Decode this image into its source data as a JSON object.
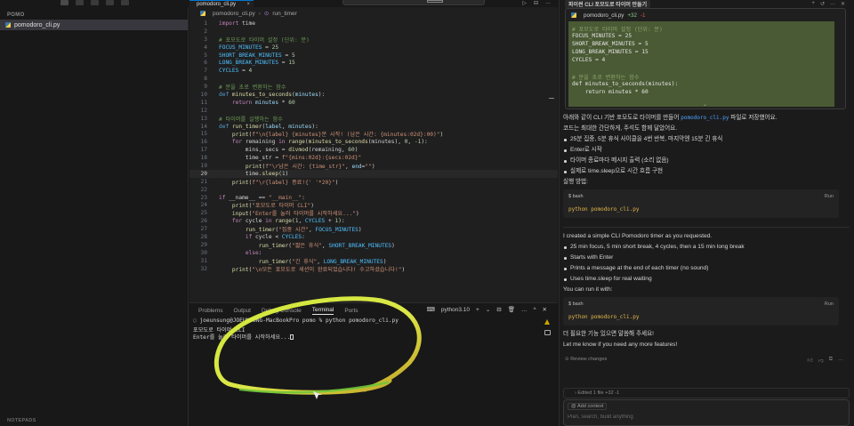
{
  "sidebar": {
    "section": "POMO",
    "file": "pomodoro_cli.py",
    "outline": "NOTEPADS"
  },
  "editor": {
    "tab": "pomodoro_cli.py",
    "breadcrumb": [
      "pomodoro_cli.py",
      "run_timer"
    ],
    "current_line": 20
  },
  "code_lines": [
    [
      {
        "t": "import",
        "c": "kw"
      },
      {
        "t": " time"
      }
    ],
    [],
    [
      {
        "t": "# 포모도로 타이머 설정 (단위: 분)",
        "c": "cm"
      }
    ],
    [
      {
        "t": "FOCUS_MINUTES",
        "c": "cn"
      },
      {
        "t": " = "
      },
      {
        "t": "25",
        "c": "nm"
      }
    ],
    [
      {
        "t": "SHORT_BREAK_MINUTES",
        "c": "cn"
      },
      {
        "t": " = "
      },
      {
        "t": "5",
        "c": "nm"
      }
    ],
    [
      {
        "t": "LONG_BREAK_MINUTES",
        "c": "cn"
      },
      {
        "t": " = "
      },
      {
        "t": "15",
        "c": "nm"
      }
    ],
    [
      {
        "t": "CYCLES",
        "c": "cn"
      },
      {
        "t": " = "
      },
      {
        "t": "4",
        "c": "nm"
      }
    ],
    [],
    [
      {
        "t": "# 분을 초로 변환하는 함수",
        "c": "cm"
      }
    ],
    [
      {
        "t": "def",
        "c": "kb"
      },
      {
        "t": " "
      },
      {
        "t": "minutes_to_seconds",
        "c": "fn"
      },
      {
        "t": "("
      },
      {
        "t": "minutes",
        "c": "pa"
      },
      {
        "t": "):"
      }
    ],
    [
      {
        "t": "    "
      },
      {
        "t": "return",
        "c": "kw"
      },
      {
        "t": " "
      },
      {
        "t": "minutes",
        "c": "pa"
      },
      {
        "t": " * "
      },
      {
        "t": "60",
        "c": "nm"
      }
    ],
    [],
    [
      {
        "t": "# 타이머를 실행하는 함수",
        "c": "cm"
      }
    ],
    [
      {
        "t": "def",
        "c": "kb"
      },
      {
        "t": " "
      },
      {
        "t": "run_timer",
        "c": "fn"
      },
      {
        "t": "("
      },
      {
        "t": "label",
        "c": "pa"
      },
      {
        "t": ", "
      },
      {
        "t": "minutes",
        "c": "pa"
      },
      {
        "t": "):"
      }
    ],
    [
      {
        "t": "    "
      },
      {
        "t": "print",
        "c": "fn"
      },
      {
        "t": "("
      },
      {
        "t": "f\"\\n{label} {minutes}분 시작! (남은 시간: {minutes:02d}:00)\"",
        "c": "st"
      },
      {
        "t": ")"
      }
    ],
    [
      {
        "t": "    "
      },
      {
        "t": "for",
        "c": "kw"
      },
      {
        "t": " remaining "
      },
      {
        "t": "in",
        "c": "kw"
      },
      {
        "t": " "
      },
      {
        "t": "range",
        "c": "fn"
      },
      {
        "t": "("
      },
      {
        "t": "minutes_to_seconds",
        "c": "fn"
      },
      {
        "t": "(minutes), "
      },
      {
        "t": "0",
        "c": "nm"
      },
      {
        "t": ", "
      },
      {
        "t": "-1",
        "c": "nm"
      },
      {
        "t": "):"
      }
    ],
    [
      {
        "t": "        mins, secs = "
      },
      {
        "t": "divmod",
        "c": "fn"
      },
      {
        "t": "(remaining, "
      },
      {
        "t": "60",
        "c": "nm"
      },
      {
        "t": ")"
      }
    ],
    [
      {
        "t": "        time_str = "
      },
      {
        "t": "f\"{mins:02d}:{secs:02d}\"",
        "c": "st"
      }
    ],
    [
      {
        "t": "        "
      },
      {
        "t": "print",
        "c": "fn"
      },
      {
        "t": "("
      },
      {
        "t": "f\"\\r남은 시간: {time_str}\"",
        "c": "st"
      },
      {
        "t": ", "
      },
      {
        "t": "end",
        "c": "pa"
      },
      {
        "t": "="
      },
      {
        "t": "\"\"",
        "c": "st"
      },
      {
        "t": ")"
      }
    ],
    [
      {
        "t": "        time."
      },
      {
        "t": "sleep",
        "c": "fn"
      },
      {
        "t": "("
      },
      {
        "t": "1",
        "c": "nm"
      },
      {
        "t": ")"
      }
    ],
    [
      {
        "t": "    "
      },
      {
        "t": "print",
        "c": "fn"
      },
      {
        "t": "("
      },
      {
        "t": "f\"\\r{label} 종료!{' '*20}\"",
        "c": "st"
      },
      {
        "t": ")"
      }
    ],
    [],
    [
      {
        "t": "if",
        "c": "kw"
      },
      {
        "t": " __name__ == "
      },
      {
        "t": "\"__main__\"",
        "c": "st"
      },
      {
        "t": ":"
      }
    ],
    [
      {
        "t": "    "
      },
      {
        "t": "print",
        "c": "fn"
      },
      {
        "t": "("
      },
      {
        "t": "\"포모도로 타이머 CLI\"",
        "c": "st"
      },
      {
        "t": ")"
      }
    ],
    [
      {
        "t": "    "
      },
      {
        "t": "input",
        "c": "fn"
      },
      {
        "t": "("
      },
      {
        "t": "\"Enter를 눌러 타이머를 시작하세요...\"",
        "c": "st"
      },
      {
        "t": ")"
      }
    ],
    [
      {
        "t": "    "
      },
      {
        "t": "for",
        "c": "kw"
      },
      {
        "t": " cycle "
      },
      {
        "t": "in",
        "c": "kw"
      },
      {
        "t": " "
      },
      {
        "t": "range",
        "c": "fn"
      },
      {
        "t": "("
      },
      {
        "t": "1",
        "c": "nm"
      },
      {
        "t": ", "
      },
      {
        "t": "CYCLES",
        "c": "cn"
      },
      {
        "t": " + "
      },
      {
        "t": "1",
        "c": "nm"
      },
      {
        "t": "):"
      }
    ],
    [
      {
        "t": "        "
      },
      {
        "t": "run_timer",
        "c": "fn"
      },
      {
        "t": "("
      },
      {
        "t": "\"집중 시간\"",
        "c": "st"
      },
      {
        "t": ", "
      },
      {
        "t": "FOCUS_MINUTES",
        "c": "cn"
      },
      {
        "t": ")"
      }
    ],
    [
      {
        "t": "        "
      },
      {
        "t": "if",
        "c": "kw"
      },
      {
        "t": " cycle < "
      },
      {
        "t": "CYCLES",
        "c": "cn"
      },
      {
        "t": ":"
      }
    ],
    [
      {
        "t": "            "
      },
      {
        "t": "run_timer",
        "c": "fn"
      },
      {
        "t": "("
      },
      {
        "t": "\"짧은 휴식\"",
        "c": "st"
      },
      {
        "t": ", "
      },
      {
        "t": "SHORT_BREAK_MINUTES",
        "c": "cn"
      },
      {
        "t": ")"
      }
    ],
    [
      {
        "t": "        "
      },
      {
        "t": "else",
        "c": "kw"
      },
      {
        "t": ":"
      }
    ],
    [
      {
        "t": "            "
      },
      {
        "t": "run_timer",
        "c": "fn"
      },
      {
        "t": "("
      },
      {
        "t": "\"긴 휴식\"",
        "c": "st"
      },
      {
        "t": ", "
      },
      {
        "t": "LONG_BREAK_MINUTES",
        "c": "cn"
      },
      {
        "t": ")"
      }
    ],
    [
      {
        "t": "    "
      },
      {
        "t": "print",
        "c": "fn"
      },
      {
        "t": "("
      },
      {
        "t": "\"\\n모든 포모도로 세션이 완료되었습니다! 수고하셨습니다!\"",
        "c": "st"
      },
      {
        "t": ")"
      }
    ]
  ],
  "panel": {
    "tabs": [
      "Problems",
      "Output",
      "Debug Console",
      "Terminal",
      "Ports"
    ],
    "active_tab": "Terminal",
    "shell": "python3.10",
    "actions": [
      "+",
      "⌄",
      "⊟",
      "🗑",
      "…",
      "^",
      "✕"
    ],
    "terminal_lines": [
      "joeunsung@JOEUNSUNG-MacBookPro pomo % python pomodoro_cli.py",
      "포모도로 타이머 CLI",
      "Enter를 눌러 타이머를 시작하세요..."
    ]
  },
  "chat": {
    "header_title": "파이썬 CLI 포모도로 타이머 만들기",
    "header_icons": [
      "+",
      "↺",
      "…",
      "✕"
    ],
    "snippet": {
      "file": "pomodoro_cli.py",
      "added": "+32",
      "removed": "-1",
      "lines": [
        {
          "t": "# 포모도로 타이머 설정 (단위: 분)",
          "c": "cm"
        },
        {
          "t": "FOCUS_MINUTES = 25"
        },
        {
          "t": "SHORT_BREAK_MINUTES = 5"
        },
        {
          "t": "LONG_BREAK_MINUTES = 15"
        },
        {
          "t": "CYCLES = 4"
        },
        {
          "t": ""
        },
        {
          "t": "# 분을 초로 변환하는 함수",
          "c": "cm"
        },
        {
          "t": "def minutes_to_seconds(minutes):"
        },
        {
          "t": "    return minutes * 60"
        }
      ]
    },
    "ko": {
      "intro_pre": "아래와 같이 CLI 기반 포모도로 타이머를 만들어 ",
      "intro_file": "pomodoro_cli.py",
      "intro_post": " 파일로 저장했어요.",
      "line2": "코드는 최대한 간단하게, 주석도 함께 달았어요.",
      "bullets": [
        "25분 집중, 5분 휴식 사이클을 4번 반복, 마지막엔 15분 긴 휴식",
        "Enter로 시작",
        "타이머 종료마다 메시지 출력 (소리 없음)",
        "실제로 time.sleep으로 시간 흐름 구현"
      ],
      "run_label": "실행 방법:",
      "block_lang": "bash",
      "block_run": "Run",
      "block_cmd": "python pomodoro_cli.py"
    },
    "en": {
      "intro": "I created a simple CLI Pomodoro timer as you requested.",
      "bullets": [
        "25 min focus, 5 min short break, 4 cycles, then a 15 min long break",
        "Starts with Enter",
        "Prints a message at the end of each timer (no sound)",
        "Uses time.sleep for real waiting"
      ],
      "run_label": "You can run it with:",
      "block_lang": "bash",
      "block_run": "Run",
      "block_cmd": "python pomodoro_cli.py",
      "closing_ko": "더 필요한 기능 있으면 말씀해 주세요!",
      "closing_en": "Let me know if you need any more features!"
    },
    "review": "Review changes",
    "edited": "Edited 1 file +32 -1",
    "add_context": "Add context",
    "input_placeholder": "Plan, search, build anything"
  }
}
